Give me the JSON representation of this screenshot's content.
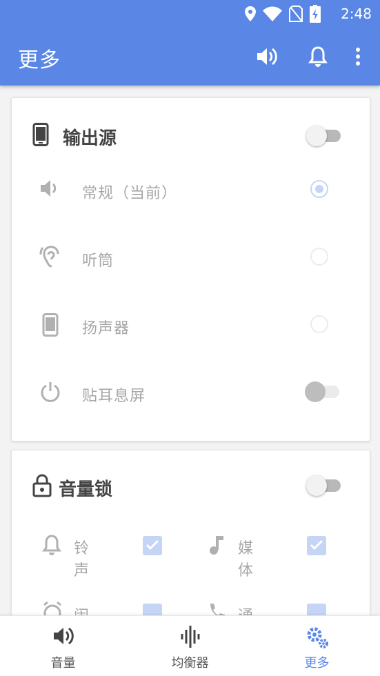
{
  "status": {
    "time": "2:48"
  },
  "appbar": {
    "title": "更多",
    "actions": [
      "volume-icon",
      "bell-icon",
      "more-vert-icon"
    ]
  },
  "output_card": {
    "title": "输出源",
    "toggle_on": false,
    "options": [
      {
        "label": "常规（当前）",
        "icon": "speaker-icon",
        "selected": true
      },
      {
        "label": "听筒",
        "icon": "ear-icon",
        "selected": false
      },
      {
        "label": "扬声器",
        "icon": "phone-icon",
        "selected": false
      }
    ],
    "proximity": {
      "label": "贴耳息屏",
      "icon": "power-icon",
      "toggle_on": false
    }
  },
  "lock_card": {
    "title": "音量锁",
    "toggle_on": false,
    "items": [
      {
        "label": "铃声",
        "icon": "bell-icon",
        "checked": true
      },
      {
        "label": "媒体",
        "icon": "music-note-icon",
        "checked": true
      },
      {
        "label": "闹钟",
        "icon": "alarm-icon",
        "checked": true
      },
      {
        "label": "通话",
        "icon": "phone-call-icon",
        "checked": true
      }
    ]
  },
  "bottom_nav": [
    {
      "label": "音量",
      "icon": "volume-icon",
      "active": false
    },
    {
      "label": "均衡器",
      "icon": "equalizer-icon",
      "active": false
    },
    {
      "label": "更多",
      "icon": "gears-icon",
      "active": true
    }
  ],
  "colors": {
    "primary": "#5a86e6",
    "disabled_accent": "#c6d5f5"
  }
}
